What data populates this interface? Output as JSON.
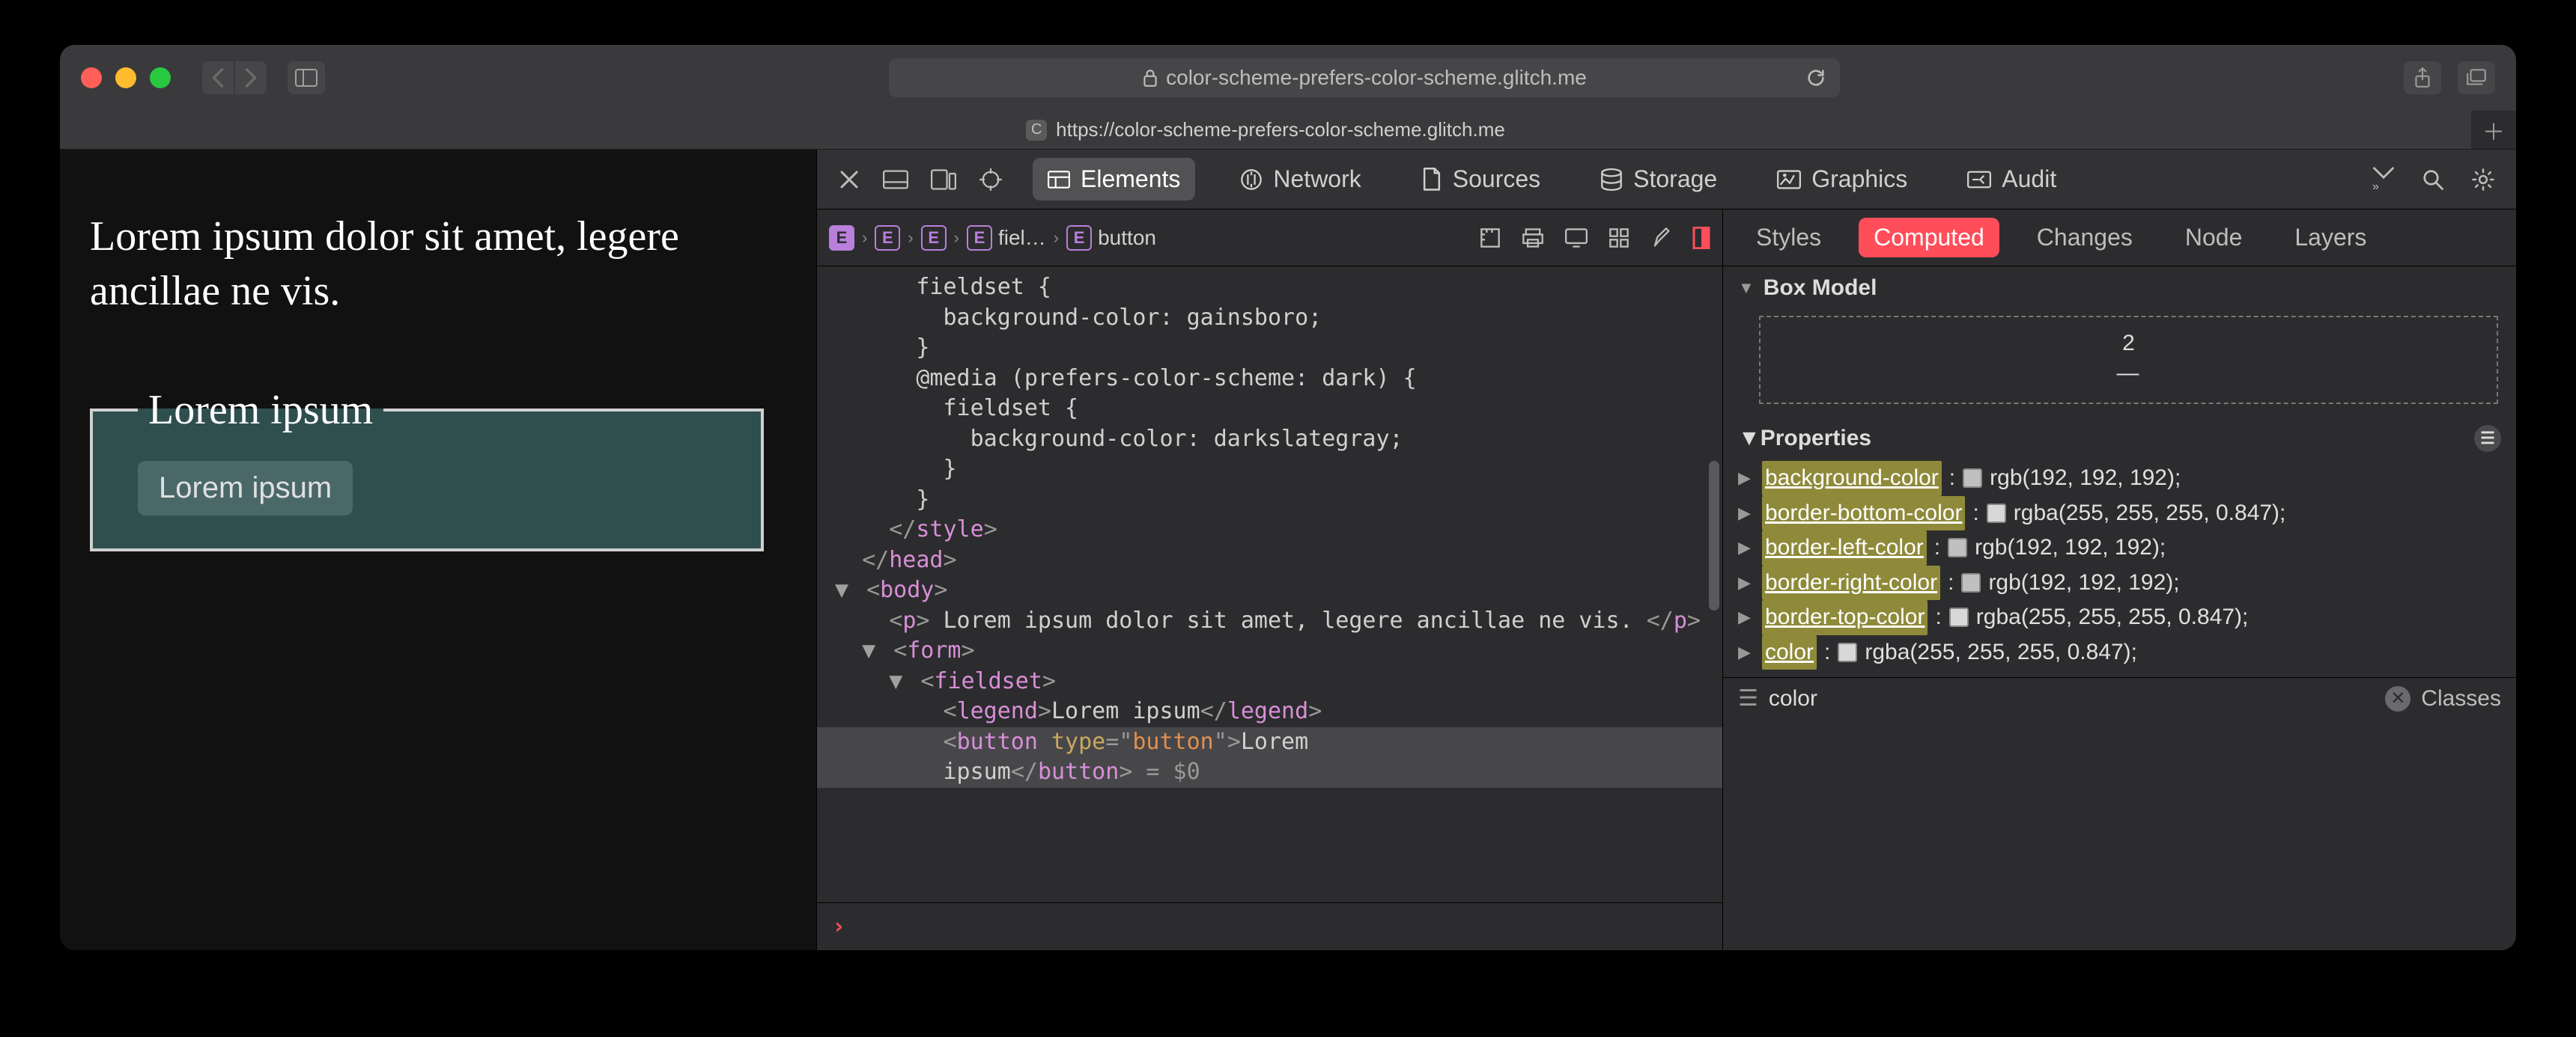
{
  "titlebar": {
    "url_display": "color-scheme-prefers-color-scheme.glitch.me"
  },
  "tab": {
    "label": "https://color-scheme-prefers-color-scheme.glitch.me",
    "favicon_letter": "C"
  },
  "page": {
    "paragraph": "Lorem ipsum dolor sit amet, legere ancillae ne vis.",
    "legend": "Lorem ipsum",
    "button": "Lorem ipsum"
  },
  "devtools": {
    "tabs": {
      "elements": "Elements",
      "network": "Network",
      "sources": "Sources",
      "storage": "Storage",
      "graphics": "Graphics",
      "audit": "Audit"
    },
    "breadcrumb": {
      "b3": "fiel…",
      "b4": "button"
    },
    "code_lines": [
      "      fieldset {",
      "        background-color: gainsboro;",
      "      }",
      "      @media (prefers-color-scheme: dark) {",
      "        fieldset {",
      "          background-color: darkslategray;",
      "        }",
      "      }"
    ],
    "close_style": "</style>",
    "close_head": "</head>",
    "body_tag": "body",
    "p_text": " Lorem ipsum dolor sit amet, legere ancillae ne vis. ",
    "form_tag": "form",
    "fieldset_tag": "fieldset",
    "legend_tag": "legend",
    "legend_text": "Lorem ipsum",
    "button_tag": "button",
    "button_attr": "type",
    "button_attr_val": "button",
    "button_text_1": "Lorem",
    "button_text_2": "ipsum",
    "eq_sel": " = $0",
    "console_prompt": "›"
  },
  "styles": {
    "tabs": {
      "styles": "Styles",
      "computed": "Computed",
      "changes": "Changes",
      "node": "Node",
      "layers": "Layers"
    },
    "box_model_label": "Box Model",
    "box_model_top": "2",
    "box_model_dash": "—",
    "properties_label": "Properties",
    "props": [
      {
        "name": "background-color",
        "val": "rgb(192, 192, 192)",
        "swatch": "#c0c0c0"
      },
      {
        "name": "border-bottom-color",
        "val": "rgba(255, 255, 255, 0.847)",
        "swatch": "#d8d8d8"
      },
      {
        "name": "border-left-color",
        "val": "rgb(192, 192, 192)",
        "swatch": "#c0c0c0"
      },
      {
        "name": "border-right-color",
        "val": "rgb(192, 192, 192)",
        "swatch": "#c0c0c0"
      },
      {
        "name": "border-top-color",
        "val": "rgba(255, 255, 255, 0.847)",
        "swatch": "#d8d8d8"
      },
      {
        "name": "color",
        "val": "rgba(255, 255, 255, 0.847)",
        "swatch": "#d8d8d8"
      }
    ],
    "filter_value": "color",
    "classes_label": "Classes"
  }
}
